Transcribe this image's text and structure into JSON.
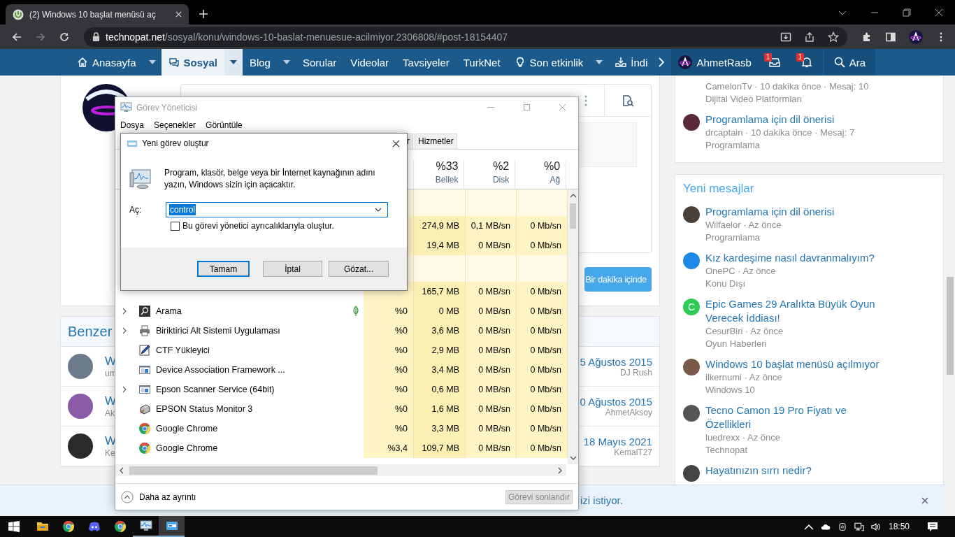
{
  "browser": {
    "tab_title": "(2) Windows 10 başlat menüsü aç",
    "url_domain": "technopat.net",
    "url_path": "/sosyal/konu/windows-10-baslat-menuesue-acilmiyor.2306808/#post-18154407"
  },
  "nav": {
    "items": [
      {
        "label": "Anasayfa",
        "kind": "home",
        "dropdown": true,
        "selected": false
      },
      {
        "label": "Sosyal",
        "kind": "chat",
        "dropdown": true,
        "selected": true
      },
      {
        "label": "Blog",
        "kind": "plain",
        "dropdown": true,
        "selected": false
      },
      {
        "label": "Sorular",
        "kind": "plain",
        "dropdown": false,
        "selected": false
      },
      {
        "label": "Videolar",
        "kind": "plain",
        "dropdown": false,
        "selected": false
      },
      {
        "label": "Tavsiyeler",
        "kind": "plain",
        "dropdown": false,
        "selected": false
      },
      {
        "label": "TurkNet",
        "kind": "plain",
        "dropdown": false,
        "selected": false
      },
      {
        "label": "Son etkinlik",
        "kind": "bulb",
        "dropdown": true,
        "selected": false
      },
      {
        "label": "İndi",
        "kind": "download",
        "dropdown": false,
        "selected": false
      }
    ],
    "user": "AhmetRasb",
    "alerts": [
      {
        "count": "1"
      },
      {
        "count": "1"
      }
    ],
    "search": "Ara"
  },
  "post": {
    "submit": "Bir dakika içinde"
  },
  "similar": {
    "title": "Benzer",
    "rows": [
      {
        "title": "W",
        "meta": "um",
        "date": "5 Ağustos 2015",
        "author": "DJ Rush",
        "color": "#6b7b8c"
      },
      {
        "title": "W",
        "meta": "Ak",
        "date": "0 Ağustos 2015",
        "author": "AhmetAksoy",
        "color": "#8a5aa8"
      },
      {
        "title": "W",
        "meta": "Ke",
        "date": "18 Mayıs 2021",
        "author": "KemalT27",
        "color": "#2a2a2a"
      }
    ]
  },
  "sidebar": {
    "recent": [
      {
        "meta": "CamelonTv · 10 dakika önce · Mesaj: 10",
        "forum": "Dijital Video Platformları"
      },
      {
        "title": "Programlama için dil önerisi",
        "meta": "drcaptain · 10 dakika önce · Mesaj: 7",
        "forum": "Programlama",
        "color": "#5a2a3a"
      }
    ],
    "new_title": "Yeni mesajlar",
    "new_messages": [
      {
        "title": "Programlama için dil önerisi",
        "meta": "Wilfaelor · Az önce",
        "forum": "Programlama",
        "color": "#4a4038"
      },
      {
        "title": "Kız kardeşime nasıl davranmalıyım?",
        "meta": "OnePC · Az önce",
        "forum": "Konu Dışı",
        "color": "#1e88e5"
      },
      {
        "title": "Epic Games 29 Aralıkta Büyük Oyun Verecek İddiası!",
        "meta": "CesurBiri · Az önce",
        "forum": "Oyun Haberleri",
        "color": "#2ecc55",
        "initial": "C"
      },
      {
        "title": "Windows 10 başlat menüsü açılmıyor",
        "meta": "ilkernumi · Az önce",
        "forum": "Windows 10",
        "color": "#7a5a48"
      },
      {
        "title": "Tecno Camon 19 Pro Fiyatı ve Özellikleri",
        "meta": "luedrexx · Az önce",
        "forum": "Technopat",
        "color": "#555555"
      },
      {
        "title": "Hayatınızın sırrı nedir?",
        "color": "#444444"
      }
    ]
  },
  "notice": {
    "text": "izi istiyor."
  },
  "task_manager": {
    "title": "Görev Yöneticisi",
    "menu": [
      "Dosya",
      "Seçenekler",
      "Görüntüle"
    ],
    "tabs": [
      {
        "label": "r",
        "selected": false
      },
      {
        "label": "Hizmetler",
        "selected": false
      }
    ],
    "columns": [
      {
        "percent": "%33",
        "label": "Bellek"
      },
      {
        "percent": "%2",
        "label": "Disk"
      },
      {
        "percent": "%0",
        "label": "Ağ"
      }
    ],
    "rows": [
      {
        "kind": "group"
      },
      {
        "kind": "hidden",
        "memory": "274,9 MB",
        "disk": "0,1 MB/sn",
        "network": "0 Mb/sn"
      },
      {
        "kind": "hidden",
        "memory": "19,4 MB",
        "disk": "0 MB/sn",
        "network": "0 Mb/sn"
      },
      {
        "kind": "group"
      },
      {
        "kind": "hidden",
        "memory": "165,7 MB",
        "disk": "0 MB/sn",
        "network": "0 Mb/sn"
      },
      {
        "kind": "search",
        "name": "Arama",
        "expandable": true,
        "eco": true,
        "cpu": "%0",
        "memory": "0 MB",
        "disk": "0 MB/sn",
        "network": "0 Mb/sn"
      },
      {
        "kind": "printer",
        "name": "Biriktirici Alt Sistemi Uygulaması",
        "expandable": true,
        "eco": false,
        "cpu": "%0",
        "memory": "3,6 MB",
        "disk": "0 MB/sn",
        "network": "0 Mb/sn"
      },
      {
        "kind": "pen",
        "name": "CTF Yükleyici",
        "expandable": false,
        "eco": false,
        "cpu": "%0",
        "memory": "2,9 MB",
        "disk": "0 MB/sn",
        "network": "0 Mb/sn"
      },
      {
        "kind": "service",
        "name": "Device Association Framework ...",
        "expandable": false,
        "eco": false,
        "cpu": "%0",
        "memory": "3,4 MB",
        "disk": "0 MB/sn",
        "network": "0 Mb/sn"
      },
      {
        "kind": "service",
        "name": "Epson Scanner Service (64bit)",
        "expandable": true,
        "eco": false,
        "cpu": "%0",
        "memory": "0,6 MB",
        "disk": "0 MB/sn",
        "network": "0 Mb/sn"
      },
      {
        "kind": "epson",
        "name": "EPSON Status Monitor 3",
        "expandable": false,
        "eco": false,
        "cpu": "%0",
        "memory": "1,6 MB",
        "disk": "0 MB/sn",
        "network": "0 Mb/sn"
      },
      {
        "kind": "chrome",
        "name": "Google Chrome",
        "expandable": false,
        "eco": false,
        "cpu": "%0",
        "memory": "3,3 MB",
        "disk": "0 MB/sn",
        "network": "0 Mb/sn"
      },
      {
        "kind": "chrome",
        "name": "Google Chrome",
        "expandable": false,
        "eco": false,
        "cpu": "%3,4",
        "memory": "109,7 MB",
        "disk": "0 MB/sn",
        "network": "0 Mb/sn"
      }
    ],
    "toggle": "Daha az ayrıntı",
    "end_task": {
      "label": "Görevi sonlandır",
      "disabled": true
    }
  },
  "run_dialog": {
    "title": "Yeni görev oluştur",
    "message": "Program, klasör, belge veya bir İnternet kaynağının adını yazın, Windows sizin için açacaktır.",
    "open_label": "Aç:",
    "value": "control",
    "value_selected": true,
    "admin": {
      "label": "Bu görevi yönetici ayrıcalıklarıyla oluştur.",
      "checked": false
    },
    "buttons": [
      {
        "label": "Tamam",
        "default": true
      },
      {
        "label": "İptal",
        "default": false
      },
      {
        "label": "Gözat...",
        "default": false
      }
    ]
  },
  "taskbar": {
    "apps": [
      {
        "kind": "explorer",
        "running": false,
        "focused": false
      },
      {
        "kind": "chrome",
        "running": false,
        "focused": false
      },
      {
        "kind": "discord",
        "running": false,
        "focused": false
      },
      {
        "kind": "chrome",
        "running": false,
        "focused": false
      },
      {
        "kind": "taskmgr",
        "running": true,
        "focused": false
      },
      {
        "kind": "run",
        "running": true,
        "focused": true
      }
    ],
    "clock": "18:50"
  }
}
